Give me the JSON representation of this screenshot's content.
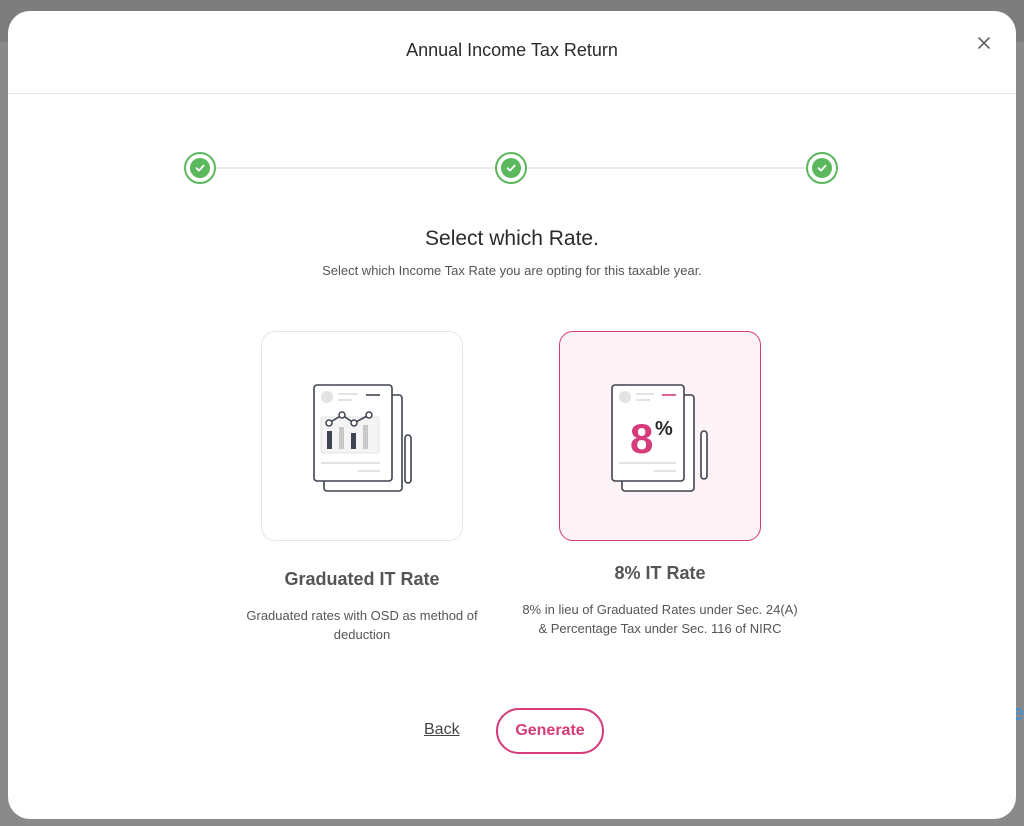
{
  "modal": {
    "title": "Annual Income Tax Return",
    "close_icon": "close-icon"
  },
  "stepper": {
    "steps": [
      {
        "state": "completed",
        "icon": "check-icon"
      },
      {
        "state": "completed",
        "icon": "check-icon"
      },
      {
        "state": "completed",
        "icon": "check-icon"
      }
    ],
    "color": "#5cb85c"
  },
  "heading": {
    "title": "Select which Rate.",
    "subtitle": "Select which Income Tax Rate you are opting for this taxable year."
  },
  "options": [
    {
      "title": "Graduated IT Rate",
      "description": "Graduated rates with OSD as method of deduction",
      "icon": "document-chart-icon",
      "selected": false
    },
    {
      "title": "8% IT Rate",
      "description": "8% in lieu of Graduated Rates under Sec. 24(A) & Percentage Tax under Sec. 116 of NIRC",
      "icon": "document-percent-icon",
      "badge_number": "8",
      "badge_symbol": "%",
      "selected": true
    }
  ],
  "actions": {
    "back_label": "Back",
    "generate_label": "Generate"
  },
  "background": {
    "peek_text": "Se"
  },
  "colors": {
    "accent": "#d63c7a",
    "success": "#5cb85c",
    "selected_bg": "#fdf3f7"
  }
}
